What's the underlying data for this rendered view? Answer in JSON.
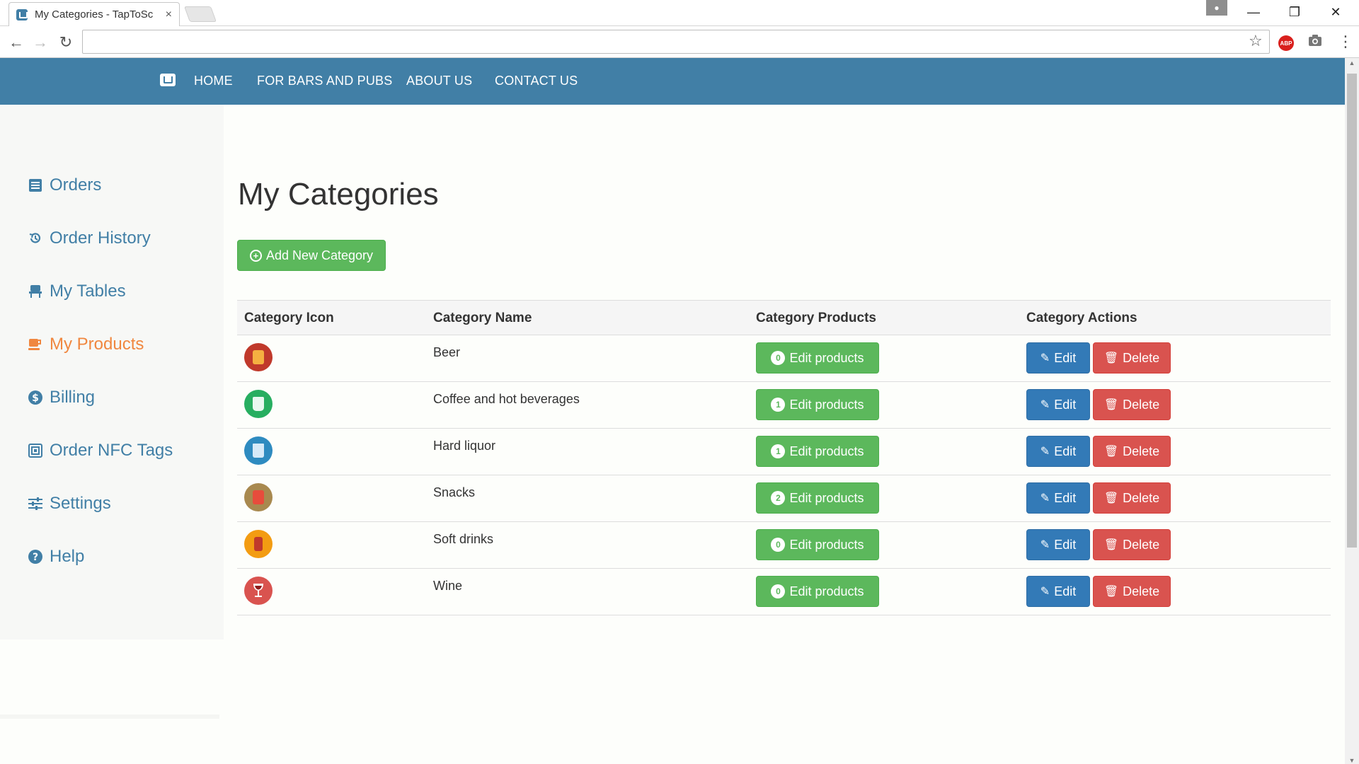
{
  "browser": {
    "tab_title": "My Categories - TapToSc",
    "tab_close": "×",
    "url": "",
    "minimize": "—",
    "restore": "❐",
    "close": "✕",
    "back": "←",
    "forward": "→",
    "reload": "↻",
    "star": "☆",
    "abp": "ABP",
    "camera": "📷",
    "menu": "⋮"
  },
  "site_nav": {
    "links": [
      "HOME",
      "FOR BARS AND PUBS",
      "ABOUT US",
      "CONTACT US"
    ]
  },
  "sidebar": {
    "items": [
      {
        "label": "Orders",
        "icon": "list-icon"
      },
      {
        "label": "Order History",
        "icon": "history-icon"
      },
      {
        "label": "My Tables",
        "icon": "chair-icon"
      },
      {
        "label": "My Products",
        "icon": "cup-icon",
        "active": true
      },
      {
        "label": "Billing",
        "icon": "dollar-icon"
      },
      {
        "label": "Order NFC Tags",
        "icon": "nfc-icon"
      },
      {
        "label": "Settings",
        "icon": "sliders-icon"
      },
      {
        "label": "Help",
        "icon": "question-icon"
      }
    ],
    "active_color": "#f0873f",
    "link_color": "#417fa6"
  },
  "main": {
    "title": "My Categories",
    "add_button": "Add New Category",
    "columns": [
      "Category Icon",
      "Category Name",
      "Category Products",
      "Category Actions"
    ],
    "rows": [
      {
        "name": "Beer",
        "count": "0",
        "icon": "beer-icon",
        "icon_color": "#c0392b"
      },
      {
        "name": "Coffee and hot beverages",
        "count": "1",
        "icon": "coffee-cup-icon",
        "icon_color": "#27ae60"
      },
      {
        "name": "Hard liquor",
        "count": "1",
        "icon": "glass-icon",
        "icon_color": "#2e8bc0"
      },
      {
        "name": "Snacks",
        "count": "2",
        "icon": "fries-icon",
        "icon_color": "#a8894f"
      },
      {
        "name": "Soft drinks",
        "count": "0",
        "icon": "can-icon",
        "icon_color": "#f39c12"
      },
      {
        "name": "Wine",
        "count": "0",
        "icon": "wine-glass-icon",
        "icon_color": "#d9534f"
      }
    ],
    "edit_products_label": "Edit products",
    "edit_label": "Edit",
    "delete_label": "Delete"
  },
  "colors": {
    "header": "#417fa6",
    "success": "#5cb85c",
    "primary": "#337ab7",
    "danger": "#d9534f"
  }
}
